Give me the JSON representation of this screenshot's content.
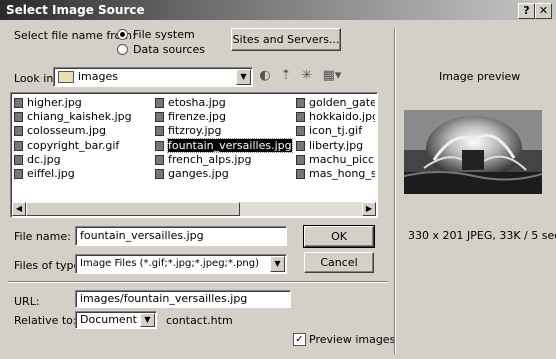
{
  "window": {
    "title": "Select Image Source",
    "help_button": "?",
    "close_button": "✕"
  },
  "select_from": {
    "label": "Select file name from:",
    "options": [
      "File system",
      "Data sources"
    ],
    "selected": "File system"
  },
  "sites_button": "Sites and Servers...",
  "look_in": {
    "label": "Look in:",
    "value": "images"
  },
  "toolbar_icons": [
    "back-icon",
    "up-folder-icon",
    "new-folder-icon",
    "view-menu-icon"
  ],
  "files": {
    "col1": [
      "higher.jpg",
      "chiang_kaishek.jpg",
      "colosseum.jpg",
      "copyright_bar.gif",
      "dc.jpg",
      "eiffel.jpg"
    ],
    "col2": [
      "etosha.jpg",
      "firenze.jpg",
      "fitzroy.jpg",
      "fountain_versailles.jpg",
      "french_alps.jpg",
      "ganges.jpg"
    ],
    "col3": [
      "golden_gate.jpg",
      "hokkaido.jpg",
      "icon_tj.gif",
      "liberty.jpg",
      "machu_picchu.jpg",
      "mas_hong_son.jpg"
    ],
    "selected": "fountain_versailles.jpg"
  },
  "file_name": {
    "label": "File name:",
    "value": "fountain_versailles.jpg"
  },
  "files_of_type": {
    "label": "Files of type:",
    "value": "Image Files (*.gif;*.jpg;*.jpeg;*.png)"
  },
  "ok_button": "OK",
  "cancel_button": "Cancel",
  "url": {
    "label": "URL:",
    "value": "images/fountain_versailles.jpg"
  },
  "relative_to": {
    "label": "Relative to:",
    "value": "Document",
    "doc": "contact.htm"
  },
  "preview_images": {
    "label": "Preview images",
    "checked": true
  },
  "preview": {
    "title": "Image preview",
    "info": "330 x 201 JPEG, 33K / 5 sec"
  }
}
